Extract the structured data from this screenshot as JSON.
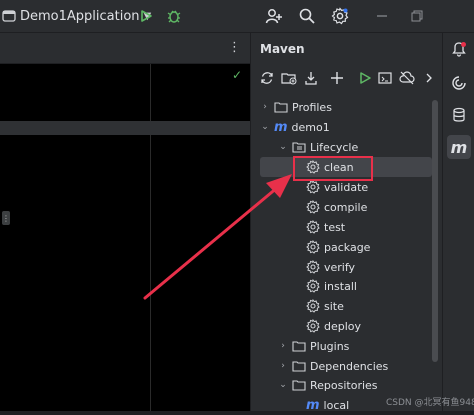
{
  "titlebar": {
    "run_config": "Demo1Application",
    "icons": [
      "run-icon",
      "debug-icon",
      "add-user-icon",
      "search-icon",
      "settings-icon",
      "minimize-icon",
      "restore-icon"
    ]
  },
  "editor": {
    "status": "ok"
  },
  "maven": {
    "title": "Maven",
    "toolbar": [
      "reload-icon",
      "add-project-icon",
      "download-icon",
      "add-icon",
      "run-icon",
      "execute-goal-icon",
      "offline-icon",
      "more-icon"
    ],
    "tree": [
      {
        "label": "Profiles",
        "expanded": false,
        "icon": "folder-icon"
      },
      {
        "label": "demo1",
        "expanded": true,
        "icon": "maven-icon"
      },
      {
        "label": "Lifecycle",
        "expanded": true,
        "icon": "folder-icon"
      },
      {
        "label": "clean",
        "selected": true,
        "icon": "gear-icon"
      },
      {
        "label": "validate",
        "icon": "gear-icon"
      },
      {
        "label": "compile",
        "icon": "gear-icon"
      },
      {
        "label": "test",
        "icon": "gear-icon"
      },
      {
        "label": "package",
        "icon": "gear-icon"
      },
      {
        "label": "verify",
        "icon": "gear-icon"
      },
      {
        "label": "install",
        "icon": "gear-icon"
      },
      {
        "label": "site",
        "icon": "gear-icon"
      },
      {
        "label": "deploy",
        "icon": "gear-icon"
      },
      {
        "label": "Plugins",
        "expanded": false,
        "icon": "folder-icon"
      },
      {
        "label": "Dependencies",
        "expanded": false,
        "icon": "folder-icon"
      },
      {
        "label": "Repositories",
        "expanded": true,
        "icon": "folder-icon"
      },
      {
        "label": "local",
        "icon": "maven-icon"
      }
    ]
  },
  "right_strip": [
    "notifications-icon",
    "copilot-icon",
    "database-icon",
    "maven-icon"
  ],
  "watermark": "CSDN @北冥有鱼9485",
  "colors": {
    "accent": "#3574f0",
    "run": "#5fb865",
    "highlight": "#e8304a",
    "bg": "#1e1f22",
    "panel": "#2b2d30"
  }
}
